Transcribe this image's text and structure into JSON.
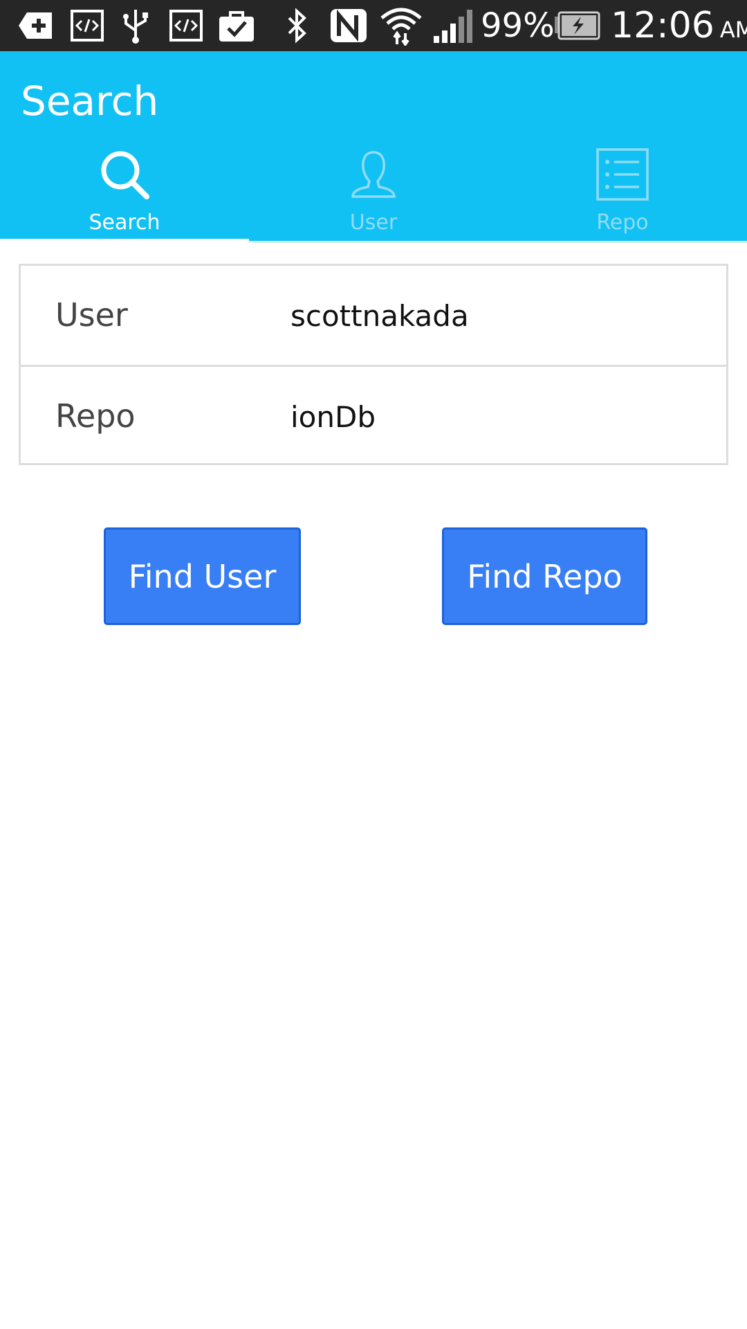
{
  "status_bar": {
    "battery_percent": "99%",
    "time": "12:06",
    "am_pm": "AM",
    "icons": [
      "add-icon",
      "code-icon",
      "usb-icon",
      "code-icon",
      "briefcase-check-icon",
      "bluetooth-icon",
      "nfc-icon",
      "wifi-icon",
      "signal-icon",
      "battery-charging-icon"
    ]
  },
  "header": {
    "title": "Search"
  },
  "tabs": [
    {
      "label": "Search",
      "icon": "search-icon",
      "active": true
    },
    {
      "label": "User",
      "icon": "user-icon",
      "active": false
    },
    {
      "label": "Repo",
      "icon": "list-icon",
      "active": false
    }
  ],
  "form": {
    "user_label": "User",
    "user_value": "scottnakada",
    "repo_label": "Repo",
    "repo_value": "ionDb"
  },
  "buttons": {
    "find_user": "Find User",
    "find_repo": "Find Repo"
  },
  "colors": {
    "app_bar": "#11c1f3",
    "button": "#387ef5",
    "status_bar": "#262626"
  }
}
